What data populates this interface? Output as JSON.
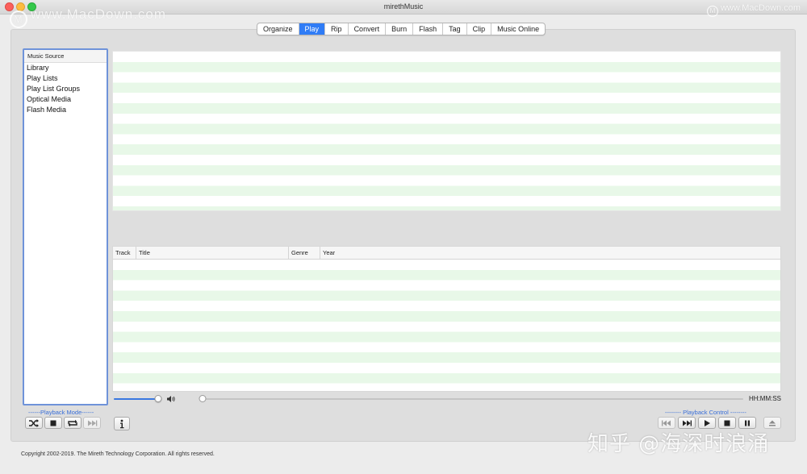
{
  "window": {
    "title": "mirethMusic"
  },
  "watermarks": {
    "left": "www.MacDown.com",
    "right": "www.MacDown.com",
    "bottom_right": "知乎 @海深时浪涌"
  },
  "tabs": [
    {
      "label": "Organize",
      "active": false
    },
    {
      "label": "Play",
      "active": true
    },
    {
      "label": "Rip",
      "active": false
    },
    {
      "label": "Convert",
      "active": false
    },
    {
      "label": "Burn",
      "active": false
    },
    {
      "label": "Flash",
      "active": false
    },
    {
      "label": "Tag",
      "active": false
    },
    {
      "label": "Clip",
      "active": false
    },
    {
      "label": "Music Online",
      "active": false
    }
  ],
  "sidebar": {
    "header": "Music Source",
    "items": [
      "Library",
      "Play Lists",
      "Play List Groups",
      "Optical Media",
      "Flash Media"
    ]
  },
  "track_table": {
    "columns": [
      "Track",
      "Title",
      "Genre",
      "Year"
    ]
  },
  "player": {
    "volume_fraction": 0.92,
    "position_fraction": 0.0,
    "time_display": "HH:MM:SS"
  },
  "playback_mode": {
    "label": "------Playback Mode------",
    "buttons": [
      "shuffle-icon",
      "stop-mode-icon",
      "repeat-icon",
      "skip-forward-icon"
    ]
  },
  "playback_control": {
    "label": "-------- Playback Control --------",
    "buttons": [
      "previous-track-icon",
      "next-track-icon",
      "play-icon",
      "stop-icon",
      "pause-icon",
      "eject-icon"
    ]
  },
  "info_button": "info-icon",
  "copyright": "Copyright 2002-2019.  The Mireth Technology Corporation. All rights reserved.",
  "colors": {
    "accent": "#2f7cf6",
    "stripe": "#e8f8e8",
    "sidebar_border": "#6f93d9"
  }
}
